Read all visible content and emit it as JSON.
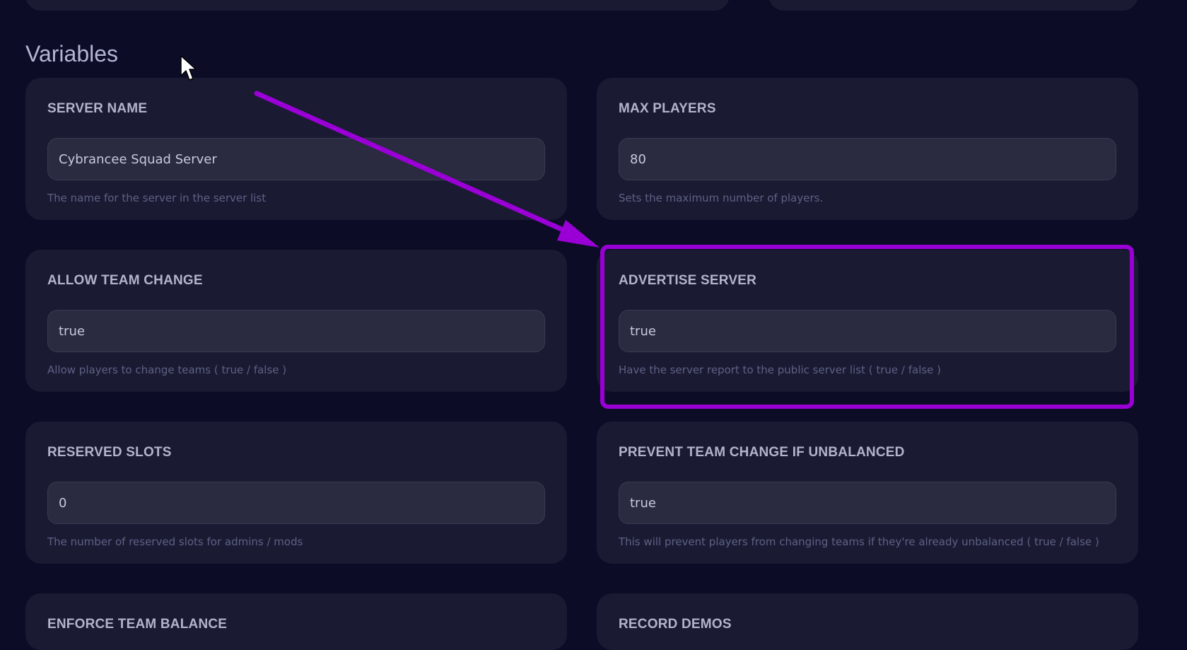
{
  "section": {
    "title": "Variables"
  },
  "variables": [
    {
      "label": "SERVER NAME",
      "value": "Cybrancee Squad Server",
      "help": "The name for the server in the server list"
    },
    {
      "label": "MAX PLAYERS",
      "value": "80",
      "help": "Sets the maximum number of players."
    },
    {
      "label": "ALLOW TEAM CHANGE",
      "value": "true",
      "help": "Allow players to change teams ( true / false )"
    },
    {
      "label": "ADVERTISE SERVER",
      "value": "true",
      "help": "Have the server report to the public server list ( true / false )"
    },
    {
      "label": "RESERVED SLOTS",
      "value": "0",
      "help": "The number of reserved slots for admins / mods"
    },
    {
      "label": "PREVENT TEAM CHANGE IF UNBALANCED",
      "value": "true",
      "help": "This will prevent players from changing teams if they're already unbalanced ( true / false )"
    },
    {
      "label": "ENFORCE TEAM BALANCE"
    },
    {
      "label": "RECORD DEMOS"
    }
  ],
  "annotation": {
    "color": "#9a00d6",
    "highlighted": "ADVERTISE SERVER"
  },
  "icons": {
    "cursor": "mouse-pointer-icon",
    "arrow": "annotation-arrow-icon"
  }
}
